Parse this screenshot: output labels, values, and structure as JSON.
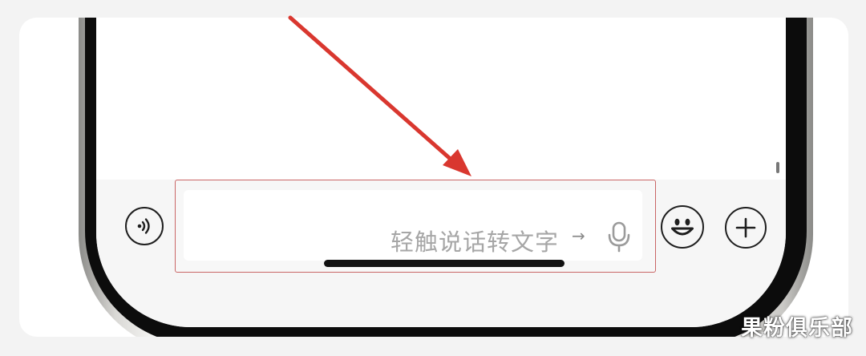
{
  "input_bar": {
    "hint_text": "轻触说话转文字",
    "hint_arrow": "→"
  },
  "icons": {
    "voice": "voice-wave-icon",
    "microphone": "microphone-icon",
    "emoji": "emoji-icon",
    "add": "plus-icon"
  },
  "annotation": {
    "arrow_color": "#d9372f",
    "highlight_color": "#c96565"
  },
  "watermark": {
    "text": "果粉俱乐部"
  }
}
